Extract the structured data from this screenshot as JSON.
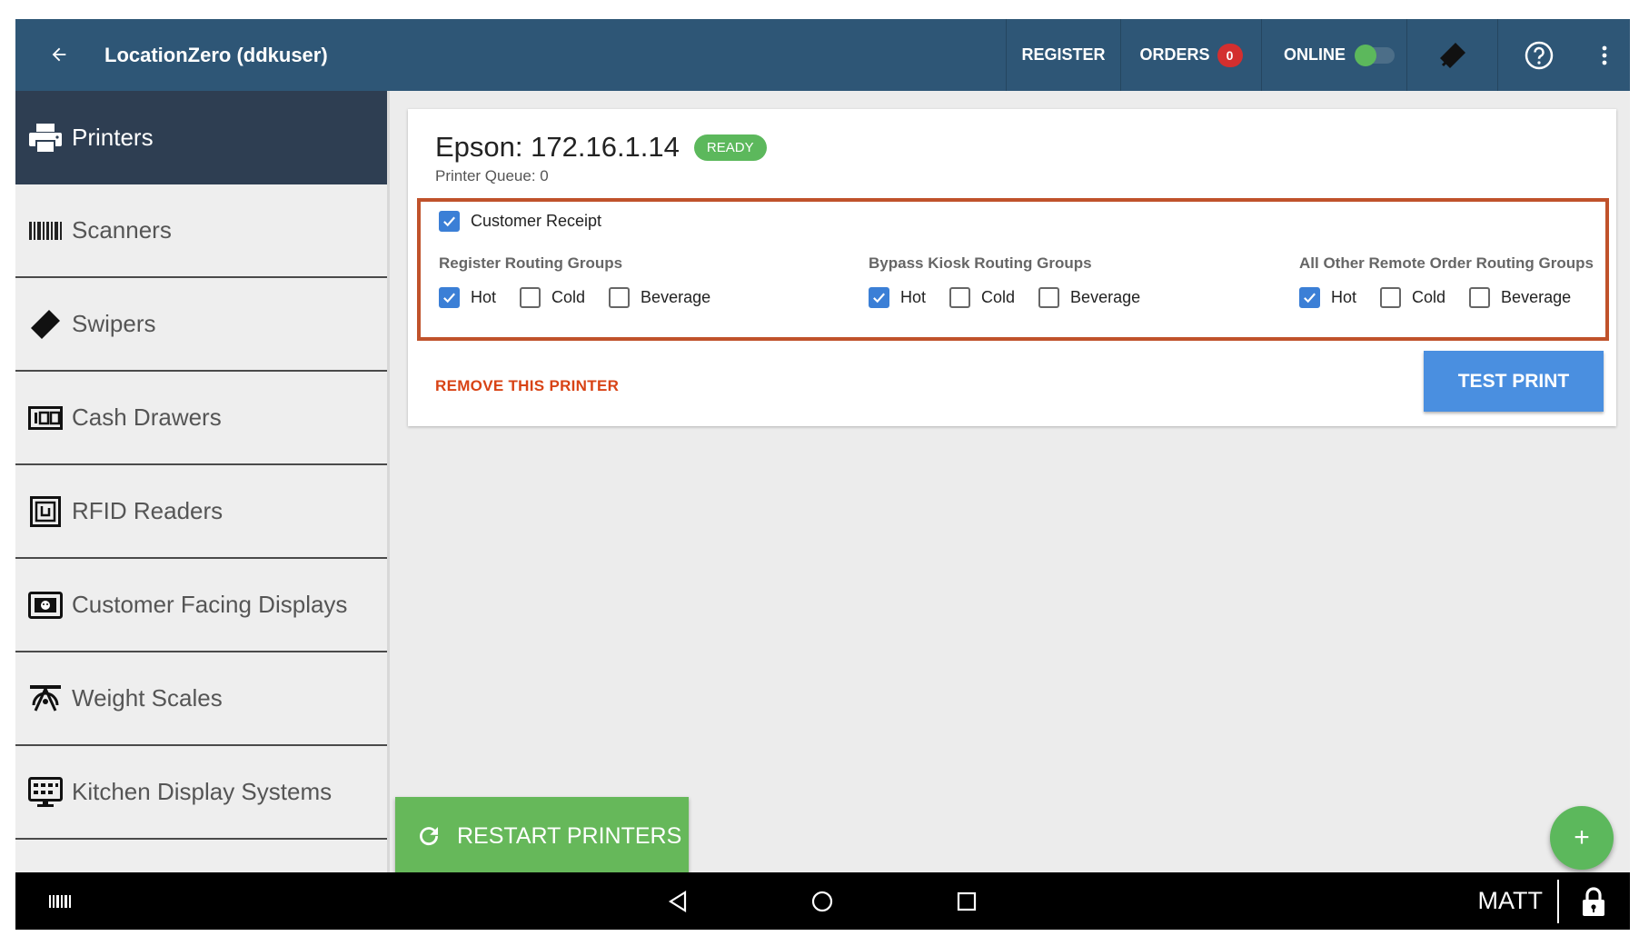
{
  "appbar": {
    "title": "LocationZero (ddkuser)",
    "register_label": "REGISTER",
    "orders_label": "ORDERS",
    "orders_count": "0",
    "online_label": "ONLINE",
    "online_on": true
  },
  "sidebar": {
    "items": [
      {
        "label": "Printers",
        "icon": "printer-icon",
        "active": true
      },
      {
        "label": "Scanners",
        "icon": "barcode-icon"
      },
      {
        "label": "Swipers",
        "icon": "swiper-icon"
      },
      {
        "label": "Cash Drawers",
        "icon": "cash-drawer-icon"
      },
      {
        "label": "RFID Readers",
        "icon": "rfid-icon"
      },
      {
        "label": "Customer Facing Displays",
        "icon": "display-icon"
      },
      {
        "label": "Weight Scales",
        "icon": "scale-icon"
      },
      {
        "label": "Kitchen Display Systems",
        "icon": "kitchen-display-icon"
      }
    ]
  },
  "printer": {
    "title": "Epson: 172.16.1.14",
    "status": "READY",
    "queue": "Printer Queue: 0",
    "customer_receipt_label": "Customer Receipt",
    "customer_receipt_checked": true,
    "groups": [
      {
        "title": "Register Routing Groups",
        "options": [
          {
            "label": "Hot",
            "checked": true
          },
          {
            "label": "Cold",
            "checked": false
          },
          {
            "label": "Beverage",
            "checked": false
          }
        ]
      },
      {
        "title": "Bypass Kiosk Routing Groups",
        "options": [
          {
            "label": "Hot",
            "checked": true
          },
          {
            "label": "Cold",
            "checked": false
          },
          {
            "label": "Beverage",
            "checked": false
          }
        ]
      },
      {
        "title": "All Other Remote Order Routing Groups",
        "options": [
          {
            "label": "Hot",
            "checked": true
          },
          {
            "label": "Cold",
            "checked": false
          },
          {
            "label": "Beverage",
            "checked": false
          }
        ]
      }
    ],
    "remove_label": "REMOVE THIS PRINTER",
    "test_print_label": "TEST PRINT"
  },
  "restart_label": "RESTART PRINTERS",
  "fab_label": "+",
  "navbar": {
    "user": "MATT"
  },
  "colors": {
    "appbar": "#2e5676",
    "sidebar_active": "#2e3e52",
    "accent_green": "#5cb85c",
    "primary_blue": "#4a8fe0",
    "danger": "#d84315",
    "highlight_border": "#c0522b"
  }
}
